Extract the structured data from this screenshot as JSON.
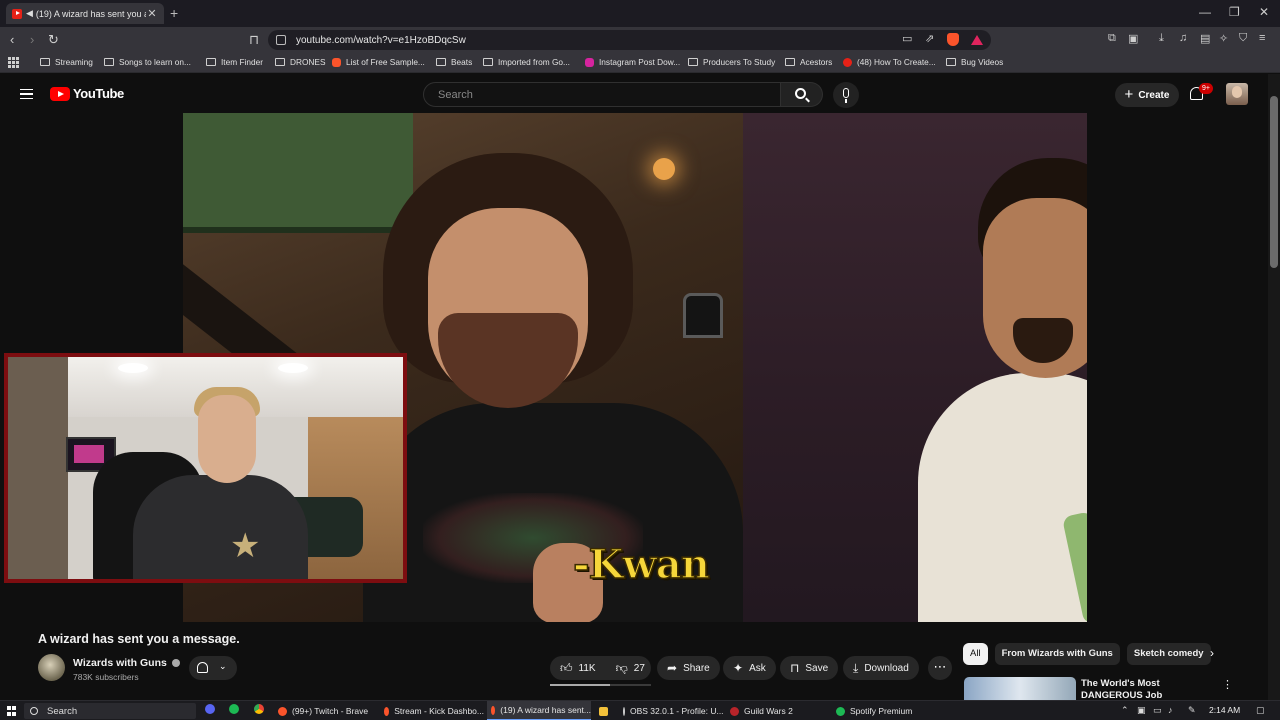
{
  "browser": {
    "tab_title": "(19) A wizard has sent you a message.",
    "url": "youtube.com/watch?v=e1HzoBDqcSw",
    "bookmarks": [
      "Streaming",
      "Songs to learn on...",
      "Item Finder",
      "DRONES",
      "List of Free Sample...",
      "Beats",
      "Imported from Go...",
      "Instagram Post Dow...",
      "Producers To Study",
      "Acestors",
      "(48) How To Create...",
      "Bug Videos"
    ]
  },
  "youtube": {
    "logo_text": "YouTube",
    "search_placeholder": "Search",
    "create_label": "Create",
    "notification_count": "9+"
  },
  "video": {
    "caption_overlay": "-Kwan",
    "title": "A wizard has sent you a message.",
    "channel_name": "Wizards with Guns",
    "subscribers": "783K subscribers",
    "likes": "11K",
    "dislikes": "27",
    "actions": {
      "share": "Share",
      "ask": "Ask",
      "save": "Save",
      "download": "Download"
    }
  },
  "recommendations": {
    "chips": [
      "All",
      "From Wizards with Guns",
      "Sketch comedy"
    ],
    "first_title": "The World's Most DANGEROUS Job"
  },
  "taskbar": {
    "search_label": "Search",
    "items": [
      "(99+) Twitch - Brave",
      "Stream - Kick Dashbo...",
      "(19) A wizard has sent...",
      "",
      "OBS 32.0.1 - Profile: U...",
      "Guild Wars 2",
      "Spotify Premium"
    ],
    "clock": "2:14 AM"
  },
  "colors": {
    "youtube_red": "#ff0000",
    "caption_yellow": "#f6d63a",
    "webcam_border": "#7d0d10",
    "page_bg": "#0f0f0f"
  }
}
